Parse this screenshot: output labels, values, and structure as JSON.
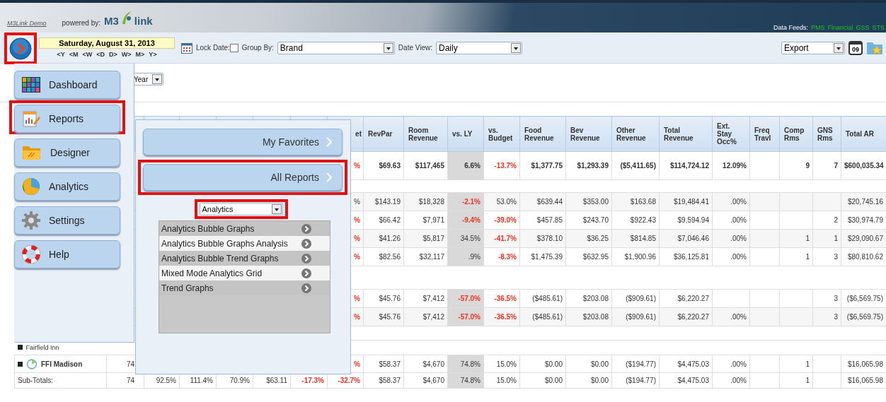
{
  "header": {
    "demo_link": "M3Link Demo",
    "powered_by": "powered by:",
    "logo_left": "M3",
    "logo_right": "link",
    "data_feeds": {
      "label": "Data Feeds:",
      "feeds": [
        "PMS",
        "Financial",
        "GSS",
        "STS"
      ]
    }
  },
  "toolbar": {
    "menu_button": {
      "highlighted": true
    },
    "date": "Saturday, August 31, 2013",
    "date_nav": [
      "<Y",
      "<M",
      "<W",
      "<D",
      "D>",
      "W>",
      "M>",
      "Y>"
    ],
    "lock_date": {
      "label": "Lock Date:",
      "checked": false
    },
    "group_by": {
      "label": "Group By:",
      "value": "Brand"
    },
    "date_view": {
      "label": "Date View:",
      "value": "Daily"
    },
    "export": {
      "value": "Export"
    },
    "calendar_badge": "09"
  },
  "filters": {
    "period": {
      "value": "Year"
    }
  },
  "menu": {
    "items": [
      {
        "label": "Dashboard",
        "kind": "grid",
        "highlighted": false
      },
      {
        "label": "Reports",
        "kind": "report",
        "highlighted": true
      },
      {
        "label": "Designer",
        "kind": "folder",
        "highlighted": false
      },
      {
        "label": "Analytics",
        "kind": "pie",
        "highlighted": false
      },
      {
        "label": "Settings",
        "kind": "gear",
        "highlighted": false
      },
      {
        "label": "Help",
        "kind": "lifebuoy",
        "highlighted": false
      }
    ]
  },
  "reports_panel": {
    "buttons": [
      {
        "label": "My Favorites",
        "highlighted": false
      },
      {
        "label": "All Reports",
        "highlighted": true
      }
    ],
    "category": {
      "value": "Analytics",
      "highlighted": true
    },
    "reports": [
      "Analytics Bubble Graphs",
      "Analytics Bubble Graphs Analysis",
      "Analytics Bubble Trend Graphs",
      "Mixed Mode Analytics Grid",
      "Trend Graphs"
    ]
  },
  "table": {
    "columns": [
      {
        "label": "et",
        "shaded": false
      },
      {
        "label": "RevPar",
        "shaded": false
      },
      {
        "label": "Room Revenue",
        "shaded": false
      },
      {
        "label": "vs. LY",
        "shaded": true
      },
      {
        "label": "vs. Budget",
        "shaded": false
      },
      {
        "label": "Food Revenue",
        "shaded": false
      },
      {
        "label": "Bev Revenue",
        "shaded": false
      },
      {
        "label": "Other Revenue",
        "shaded": false
      },
      {
        "label": "Total Revenue",
        "shaded": false
      },
      {
        "label": "Ext. Stay Occ%",
        "shaded": false
      },
      {
        "label": "Freq Travl",
        "shaded": false
      },
      {
        "label": "Comp Rms",
        "shaded": false
      },
      {
        "label": "GNS Rms",
        "shaded": false
      },
      {
        "label": "Total AR",
        "shaded": false
      }
    ],
    "rows": [
      {
        "kind": "total",
        "cells": [
          null,
          null,
          null,
          null,
          null,
          null,
          null,
          {
            "text": "%",
            "alert": true
          },
          "$69.63",
          "$117,465",
          "6.6%",
          {
            "text": "-13.7%",
            "alert": true
          },
          "$1,377.75",
          "$1,293.39",
          "($5,411.65)",
          "$114,724.12",
          "12.09%",
          null,
          "9",
          "7",
          "$600,035.34"
        ]
      },
      {
        "kind": "spacer"
      },
      {
        "kind": "data",
        "cells": [
          null,
          null,
          null,
          null,
          null,
          null,
          null,
          "%",
          "$143.19",
          "$18,328",
          {
            "text": "-2.1%",
            "alert": true
          },
          "53.0%",
          "$639.44",
          "$353.00",
          "$163.68",
          "$19,484.41",
          ".00%",
          null,
          null,
          null,
          "$20,745.16"
        ]
      },
      {
        "kind": "data",
        "cells": [
          null,
          null,
          null,
          null,
          null,
          null,
          null,
          {
            "text": "%",
            "alert": true
          },
          "$66.42",
          "$7,971",
          {
            "text": "-9.4%",
            "alert": true
          },
          {
            "text": "-39.0%",
            "alert": true
          },
          "$457.85",
          "$243.70",
          "$922.43",
          "$9,594.94",
          ".00%",
          null,
          null,
          "2",
          "$30,974.79"
        ]
      },
      {
        "kind": "data",
        "cells": [
          null,
          null,
          null,
          null,
          null,
          null,
          null,
          {
            "text": "%",
            "alert": true
          },
          "$41.26",
          "$5,817",
          "34.5%",
          {
            "text": "-41.7%",
            "alert": true
          },
          "$378.10",
          "$36.25",
          "$814.85",
          "$7,046.46",
          ".00%",
          null,
          "1",
          "1",
          "$29,090.67"
        ]
      },
      {
        "kind": "data",
        "cells": [
          null,
          null,
          null,
          null,
          null,
          null,
          null,
          {
            "text": "%",
            "alert": true
          },
          "$82.56",
          "$32,117",
          ".9%",
          {
            "text": "-8.3%",
            "alert": true
          },
          "$1,475.39",
          "$632.95",
          "$1,900.96",
          "$36,125.81",
          ".00%",
          null,
          "1",
          "3",
          "$80,810.62"
        ]
      },
      {
        "kind": "spacer"
      },
      {
        "kind": "data",
        "cells": [
          null,
          null,
          null,
          null,
          null,
          null,
          null,
          {
            "text": "%",
            "alert": true
          },
          "$45.76",
          "$7,412",
          {
            "text": "-57.0%",
            "alert": true
          },
          {
            "text": "-36.5%",
            "alert": true
          },
          "($485.61)",
          "$203.08",
          "($909.61)",
          "$6,220.27",
          null,
          null,
          null,
          "3",
          "($6,569.75)"
        ]
      },
      {
        "kind": "data",
        "cells": [
          null,
          null,
          null,
          null,
          null,
          null,
          null,
          {
            "text": "%",
            "alert": true
          },
          "$45.76",
          "$7,412",
          {
            "text": "-57.0%",
            "alert": true
          },
          {
            "text": "-36.5%",
            "alert": true
          },
          "($485.61)",
          "$203.08",
          "($909.61)",
          "$6,220.27",
          ".00%",
          null,
          null,
          "3",
          "($6,569.75)"
        ]
      },
      {
        "kind": "spacer"
      },
      {
        "kind": "group",
        "name": "Fairfield Inn",
        "expanded": true
      },
      {
        "kind": "property",
        "name": "FFI Madison",
        "expanded": true,
        "cells": [
          null,
          "74",
          null,
          null,
          null,
          null,
          null,
          {
            "text": "%",
            "alert": true
          },
          "$58.37",
          "$4,670",
          "74.8%",
          "15.0%",
          "$0.00",
          "$0.00",
          "($194.77)",
          "$4,475.03",
          ".00%",
          null,
          "1",
          null,
          "$16,065.98"
        ]
      },
      {
        "kind": "subtotal",
        "name": "Sub-Totals:",
        "cells": [
          null,
          "74",
          "92.5%",
          "111.4%",
          "70.9%",
          "$63.11",
          {
            "text": "-17.3%",
            "alert": true
          },
          {
            "text": "-32.7%",
            "alert": true
          },
          "$58.37",
          "$4,670",
          "74.8%",
          "15.0%",
          "$0.00",
          "$0.00",
          "($194.77)",
          "$4,475.03",
          ".00%",
          null,
          "1",
          null,
          "$16,065.98"
        ]
      }
    ]
  }
}
